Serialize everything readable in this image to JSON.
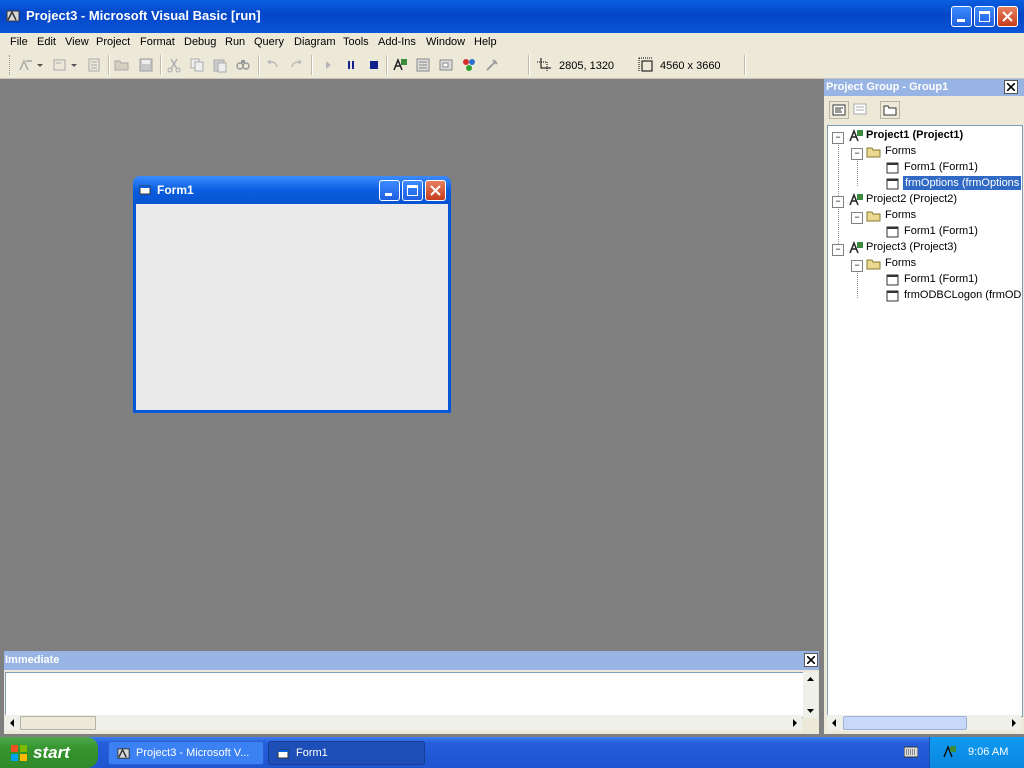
{
  "window": {
    "title": "Project3 - Microsoft Visual Basic [run]"
  },
  "menu": {
    "items": [
      "File",
      "Edit",
      "View",
      "Project",
      "Format",
      "Debug",
      "Run",
      "Query",
      "Diagram",
      "Tools",
      "Add-Ins",
      "Window",
      "Help"
    ]
  },
  "toolbar": {
    "position": "2805, 1320",
    "size": "4560 x 3660"
  },
  "form": {
    "title": "Form1"
  },
  "immediate": {
    "title": "Immediate"
  },
  "project_group": {
    "title": "Project Group - Group1",
    "tree": [
      {
        "label": "Project1 (Project1)",
        "bold": true
      },
      {
        "label": "Forms"
      },
      {
        "label": "Form1 (Form1)"
      },
      {
        "label": "frmOptions (frmOptions",
        "selected": true
      },
      {
        "label": "Project2 (Project2)"
      },
      {
        "label": "Forms"
      },
      {
        "label": "Form1 (Form1)"
      },
      {
        "label": "Project3 (Project3)"
      },
      {
        "label": "Forms"
      },
      {
        "label": "Form1 (Form1)"
      },
      {
        "label": "frmODBCLogon (frmODI"
      }
    ]
  },
  "taskbar": {
    "start_label": "start",
    "items": [
      "Project3 - Microsoft V...",
      "Form1"
    ],
    "clock": "9:06 AM"
  },
  "colors": {
    "title_blue": "#0a5ee0",
    "panel_header": "#98b4e4",
    "workspace_gray": "#808080",
    "selection": "#316ac5",
    "start_green": "#35942d"
  }
}
